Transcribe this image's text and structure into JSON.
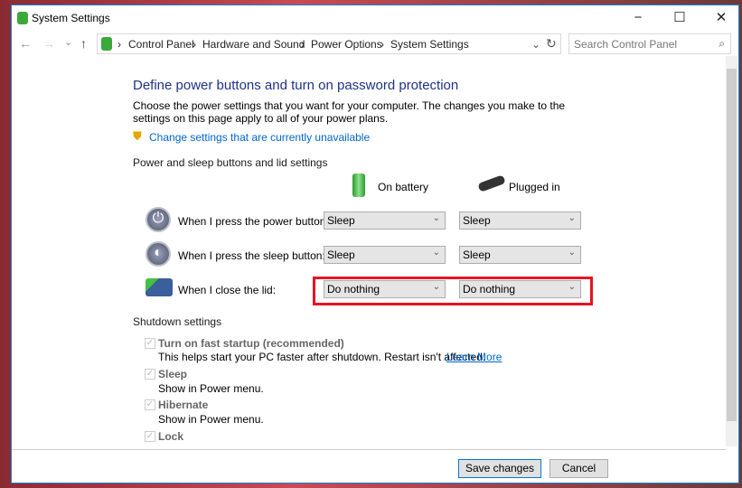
{
  "window": {
    "title": "System Settings",
    "minimize": "−",
    "maximize": "☐",
    "close": "✕"
  },
  "nav": {
    "back": "←",
    "forward": "→",
    "recent": "⌄",
    "up": "↑",
    "refresh": "↻",
    "dropdown": "⌄"
  },
  "breadcrumb": [
    "Control Panel",
    "Hardware and Sound",
    "Power Options",
    "System Settings"
  ],
  "search": {
    "placeholder": "Search Control Panel"
  },
  "main": {
    "heading": "Define power buttons and turn on password protection",
    "description": "Choose the power settings that you want for your computer. The changes you make to the settings on this page apply to all of your power plans.",
    "change_link": "Change settings that are currently unavailable",
    "section_buttons": "Power and sleep buttons and lid settings",
    "col_battery": "On battery",
    "col_plugged": "Plugged in",
    "rows": [
      {
        "label": "When I press the power button:",
        "battery": "Sleep",
        "plugged": "Sleep",
        "icon": "power-icon"
      },
      {
        "label": "When I press the sleep button:",
        "battery": "Sleep",
        "plugged": "Sleep",
        "icon": "sleep-icon"
      },
      {
        "label": "When I close the lid:",
        "battery": "Do nothing",
        "plugged": "Do nothing",
        "icon": "laptop-lid-icon"
      }
    ],
    "highlight_color": "#e81123",
    "section_shutdown": "Shutdown settings",
    "shutdown": [
      {
        "label": "Turn on fast startup (recommended)",
        "desc": "This helps start your PC faster after shutdown. Restart isn't affected.",
        "link": "Learn More",
        "checked": true
      },
      {
        "label": "Sleep",
        "desc": "Show in Power menu.",
        "checked": true
      },
      {
        "label": "Hibernate",
        "desc": "Show in Power menu.",
        "checked": true
      },
      {
        "label": "Lock",
        "checked": true
      }
    ]
  },
  "footer": {
    "save": "Save changes",
    "cancel": "Cancel"
  }
}
